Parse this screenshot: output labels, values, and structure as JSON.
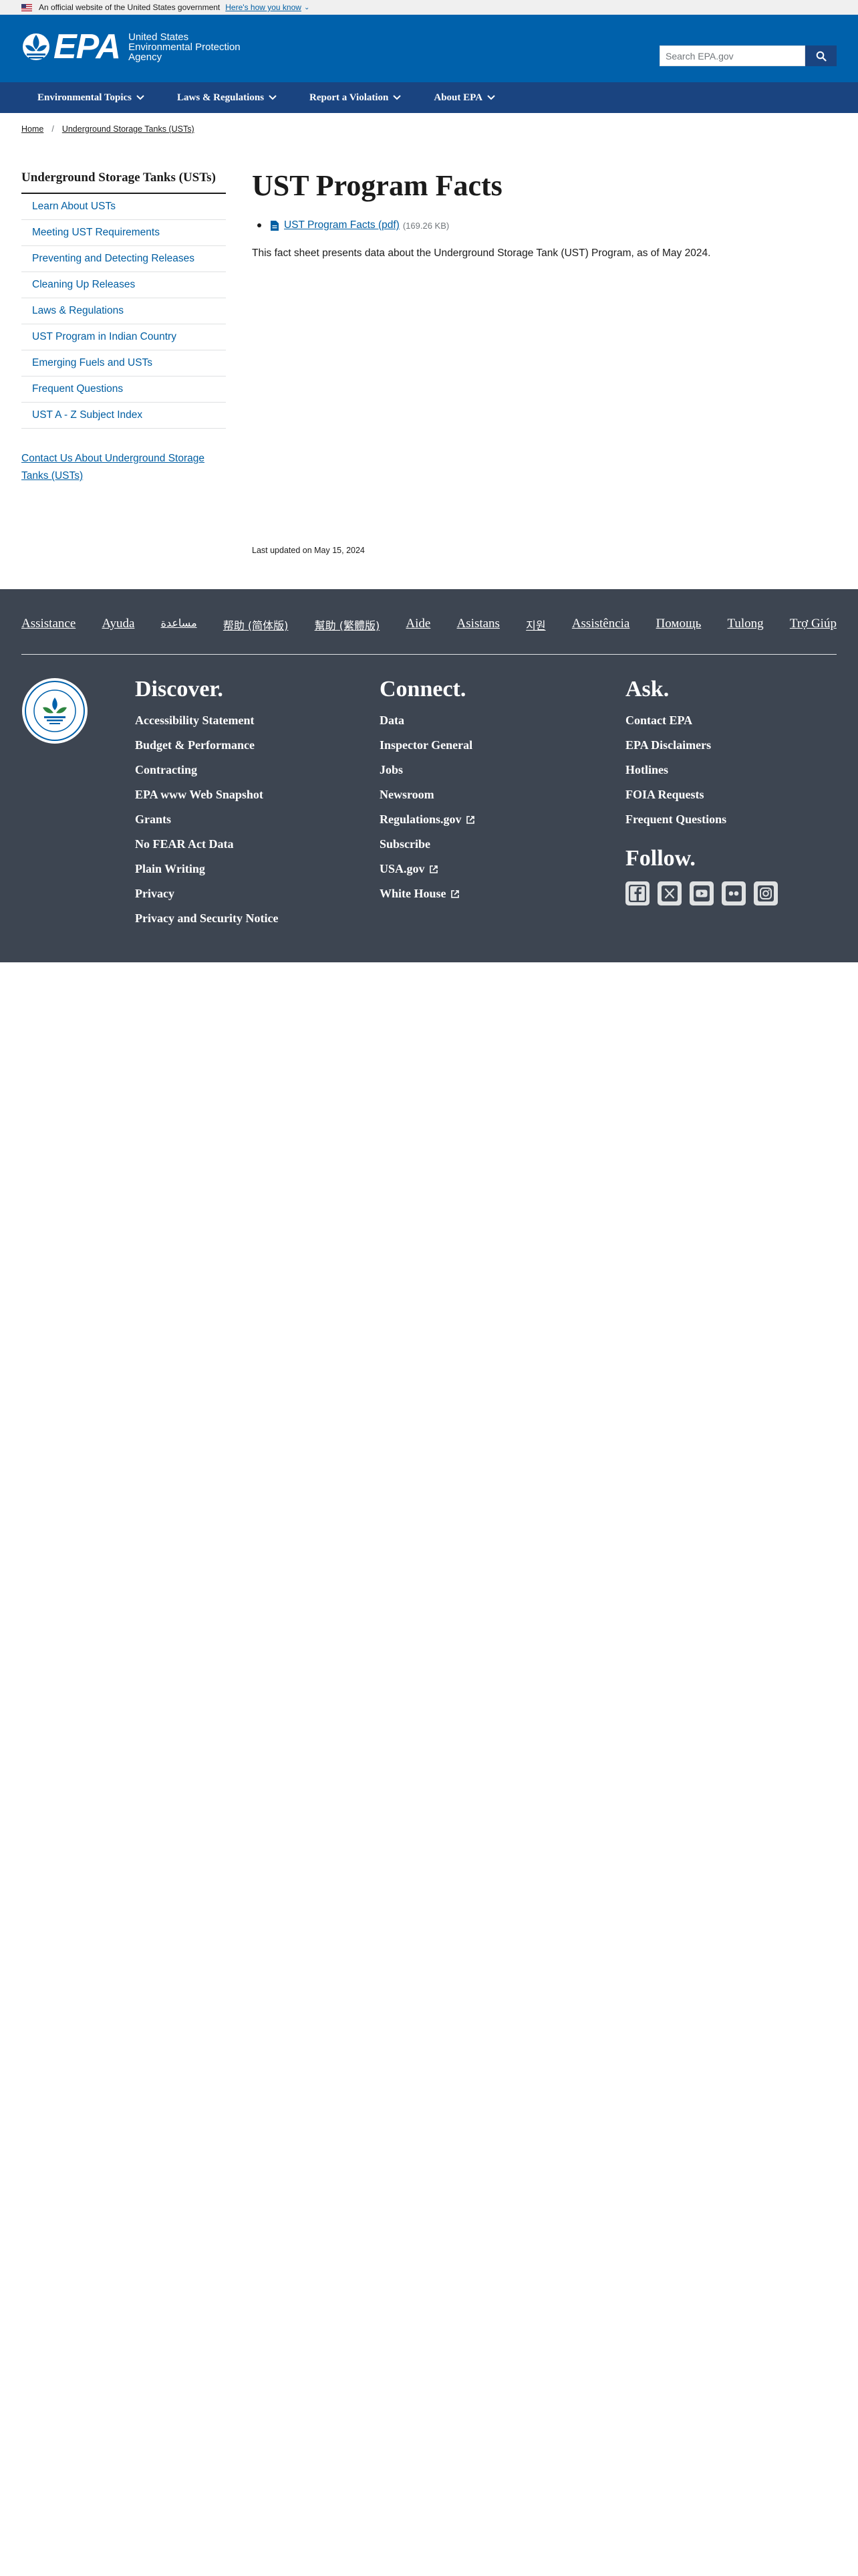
{
  "gov_banner": {
    "text": "An official website of the United States government",
    "link": "Here's how you know"
  },
  "header": {
    "logo_text": "EPA",
    "agency_name": "United States\nEnvironmental Protection\nAgency",
    "search_placeholder": "Search EPA.gov"
  },
  "nav": [
    {
      "label": "Environmental Topics"
    },
    {
      "label": "Laws & Regulations"
    },
    {
      "label": "Report a Violation"
    },
    {
      "label": "About EPA"
    }
  ],
  "breadcrumb": [
    "Home",
    "Underground Storage Tanks (USTs)"
  ],
  "sidebar": {
    "title": "Underground Storage Tanks (USTs)",
    "items": [
      "Learn About USTs",
      "Meeting UST Requirements",
      "Preventing and Detecting Releases",
      "Cleaning Up Releases",
      "Laws & Regulations",
      "UST Program in Indian Country",
      "Emerging Fuels and USTs",
      "Frequent Questions",
      "UST A - Z Subject Index"
    ],
    "contact": "Contact Us About Underground Storage Tanks (USTs)"
  },
  "main": {
    "title": "UST Program Facts",
    "document_link": "UST Program Facts (pdf)",
    "document_size": "(169.26 KB)",
    "intro": "This fact sheet presents data about the Underground Storage Tank (UST) Program, as of May 2024.",
    "last_updated": "Last updated on May 15, 2024"
  },
  "footer": {
    "languages": [
      "Assistance",
      "Ayuda",
      "مساعدة",
      "帮助 (简体版)",
      "幫助 (繁體版)",
      "Aide",
      "Asistans",
      "지원",
      "Assistência",
      "Помощь",
      "Tulong",
      "Trợ Giúp"
    ],
    "discover": {
      "title": "Discover.",
      "links": [
        "Accessibility Statement",
        "Budget & Performance",
        "Contracting",
        "EPA www Web Snapshot",
        "Grants",
        "No FEAR Act Data",
        "Plain Writing",
        "Privacy",
        "Privacy and Security Notice"
      ]
    },
    "connect": {
      "title": "Connect.",
      "links": [
        "Data",
        "Inspector General",
        "Jobs",
        "Newsroom",
        "Regulations.gov",
        "Subscribe",
        "USA.gov",
        "White House"
      ]
    },
    "ask": {
      "title": "Ask.",
      "links": [
        "Contact EPA",
        "EPA Disclaimers",
        "Hotlines",
        "FOIA Requests",
        "Frequent Questions"
      ]
    },
    "follow": {
      "title": "Follow.",
      "icons": [
        "facebook-icon",
        "x-icon",
        "youtube-icon",
        "flickr-icon",
        "instagram-icon"
      ]
    }
  },
  "colors": {
    "header_blue": "#0061ab",
    "nav_blue": "#1a4480",
    "link_blue": "#005ea2",
    "footer_gray": "#3d4551"
  }
}
